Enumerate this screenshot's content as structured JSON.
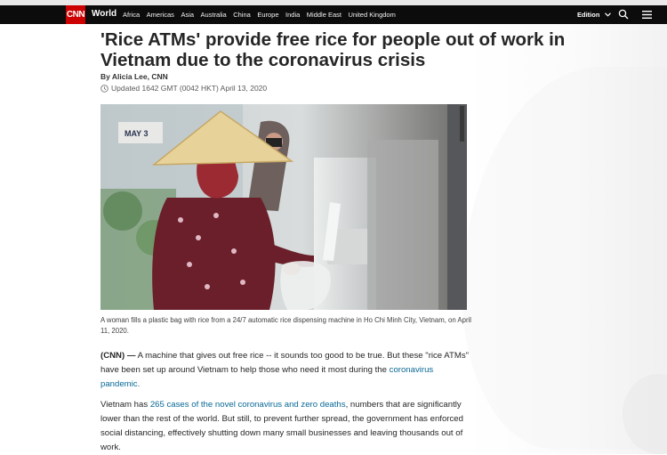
{
  "navbar": {
    "logo": "CNN",
    "section": "World",
    "links": [
      "Africa",
      "Americas",
      "Asia",
      "Australia",
      "China",
      "Europe",
      "India",
      "Middle East",
      "United Kingdom"
    ],
    "edition_label": "Edition",
    "icons": {
      "search": "search-icon",
      "menu": "hamburger-menu-icon",
      "edition": "chevron-down-icon"
    }
  },
  "article": {
    "headline": "'Rice ATMs' provide free rice for people out of work in Vietnam due to the coronavirus crisis",
    "byline": "By Alicia Lee, CNN",
    "updated": "Updated 1642 GMT (0042 HKT) April 13, 2020",
    "image_caption": "A woman fills a plastic bag with rice from a 24/7 automatic rice dispensing machine in Ho Chi Minh City, Vietnam, on April 11, 2020.",
    "image_sign": "MAY 3",
    "p1": {
      "dateline": "(CNN) —",
      "text": " A machine that gives out free rice -- it sounds too good to be true. But these \"rice ATMs\" have been set up around Vietnam to help those who need it most during the ",
      "link": "coronavirus pandemic.",
      "end": ""
    },
    "p2": {
      "start": "Vietnam has ",
      "link": "265 cases of the novel coronavirus and zero deaths",
      "text": ", numbers that are significantly lower than the rest of the world. But still, to prevent further spread, the government has enforced social distancing, effectively shutting down many small businesses and leaving thousands out of work."
    }
  },
  "colors": {
    "brand": "#cc0000",
    "navbar": "#0c0c0c",
    "link": "#096996"
  }
}
